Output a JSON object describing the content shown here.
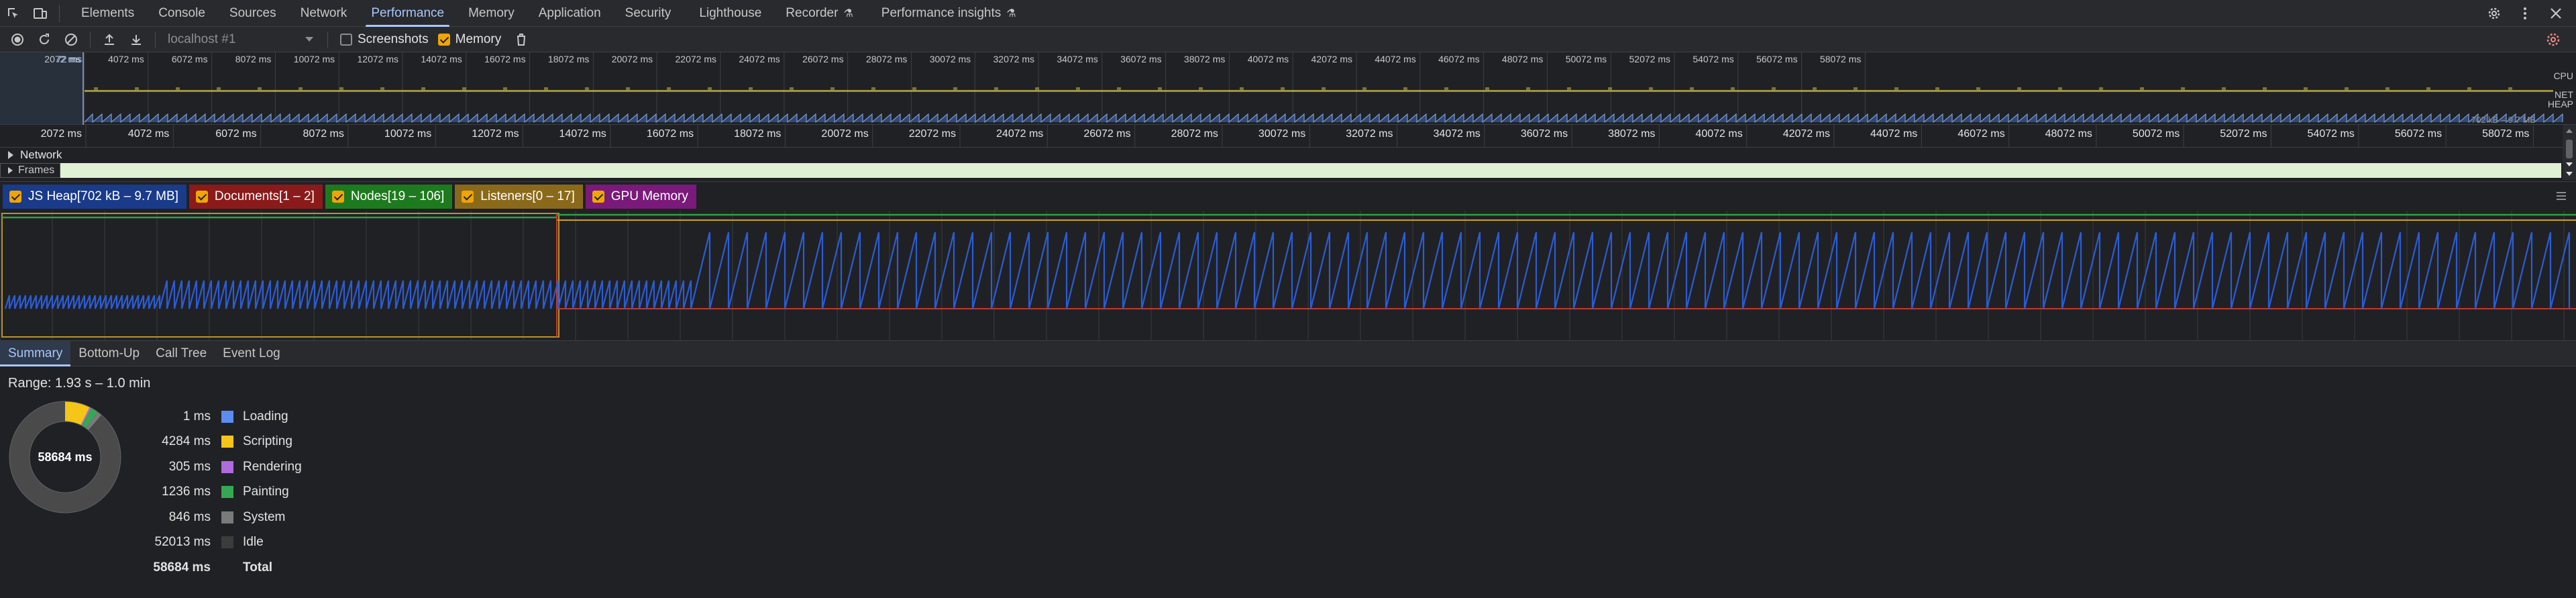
{
  "tabs": [
    {
      "label": "Elements"
    },
    {
      "label": "Console"
    },
    {
      "label": "Sources"
    },
    {
      "label": "Network"
    },
    {
      "label": "Performance"
    },
    {
      "label": "Memory"
    },
    {
      "label": "Application"
    },
    {
      "label": "Security"
    },
    {
      "label": "Lighthouse"
    },
    {
      "label": "Recorder"
    },
    {
      "label": "Performance insights"
    }
  ],
  "active_tab": "Performance",
  "toolbar": {
    "target": "localhost #1",
    "screenshots_label": "Screenshots",
    "screenshots_checked": false,
    "memory_label": "Memory",
    "memory_checked": true
  },
  "overview": {
    "selected_time": "72 ms",
    "track_labels": [
      "CPU",
      "NET",
      "HEAP"
    ],
    "heap_range": "702 kB – 9.7 MB",
    "ticks": [
      "2072 ms",
      "4072 ms",
      "6072 ms",
      "8072 ms",
      "10072 ms",
      "12072 ms",
      "14072 ms",
      "16072 ms",
      "18072 ms",
      "20072 ms",
      "22072 ms",
      "24072 ms",
      "26072 ms",
      "28072 ms",
      "30072 ms",
      "32072 ms",
      "34072 ms",
      "36072 ms",
      "38072 ms",
      "40072 ms",
      "42072 ms",
      "44072 ms",
      "46072 ms",
      "48072 ms",
      "50072 ms",
      "52072 ms",
      "54072 ms",
      "56072 ms",
      "58072 ms"
    ]
  },
  "main_ruler": {
    "ticks": [
      "2072 ms",
      "4072 ms",
      "6072 ms",
      "8072 ms",
      "10072 ms",
      "12072 ms",
      "14072 ms",
      "16072 ms",
      "18072 ms",
      "20072 ms",
      "22072 ms",
      "24072 ms",
      "26072 ms",
      "28072 ms",
      "30072 ms",
      "32072 ms",
      "34072 ms",
      "36072 ms",
      "38072 ms",
      "40072 ms",
      "42072 ms",
      "44072 ms",
      "46072 ms",
      "48072 ms",
      "50072 ms",
      "52072 ms",
      "54072 ms",
      "56072 ms",
      "58072 ms"
    ]
  },
  "tracks": {
    "network": "Network",
    "frames": "Frames"
  },
  "memory_legend": [
    {
      "label": "JS Heap[702 kB – 9.7 MB]",
      "color": "#1a3a8a"
    },
    {
      "label": "Documents[1 – 2]",
      "color": "#8b1a1a"
    },
    {
      "label": "Nodes[19 – 106]",
      "color": "#1e7a1e"
    },
    {
      "label": "Listeners[0 – 17]",
      "color": "#8a6a1a"
    },
    {
      "label": "GPU Memory",
      "color": "#7a1a7a"
    }
  ],
  "bottom_tabs": [
    {
      "label": "Summary"
    },
    {
      "label": "Bottom-Up"
    },
    {
      "label": "Call Tree"
    },
    {
      "label": "Event Log"
    }
  ],
  "summary": {
    "range": "Range: 1.93 s – 1.0 min",
    "total_label": "58684 ms",
    "categories": [
      {
        "value": "1 ms",
        "name": "Loading",
        "color": "#5b8def",
        "ms": 1
      },
      {
        "value": "4284 ms",
        "name": "Scripting",
        "color": "#f5c518",
        "ms": 4284
      },
      {
        "value": "305 ms",
        "name": "Rendering",
        "color": "#b06bdc",
        "ms": 305
      },
      {
        "value": "1236 ms",
        "name": "Painting",
        "color": "#35a853",
        "ms": 1236
      },
      {
        "value": "846 ms",
        "name": "System",
        "color": "#7a7a7a",
        "ms": 846
      },
      {
        "value": "52013 ms",
        "name": "Idle",
        "color": "#3c3c3c",
        "ms": 52013
      }
    ],
    "total": {
      "value": "58684 ms",
      "name": "Total"
    }
  }
}
